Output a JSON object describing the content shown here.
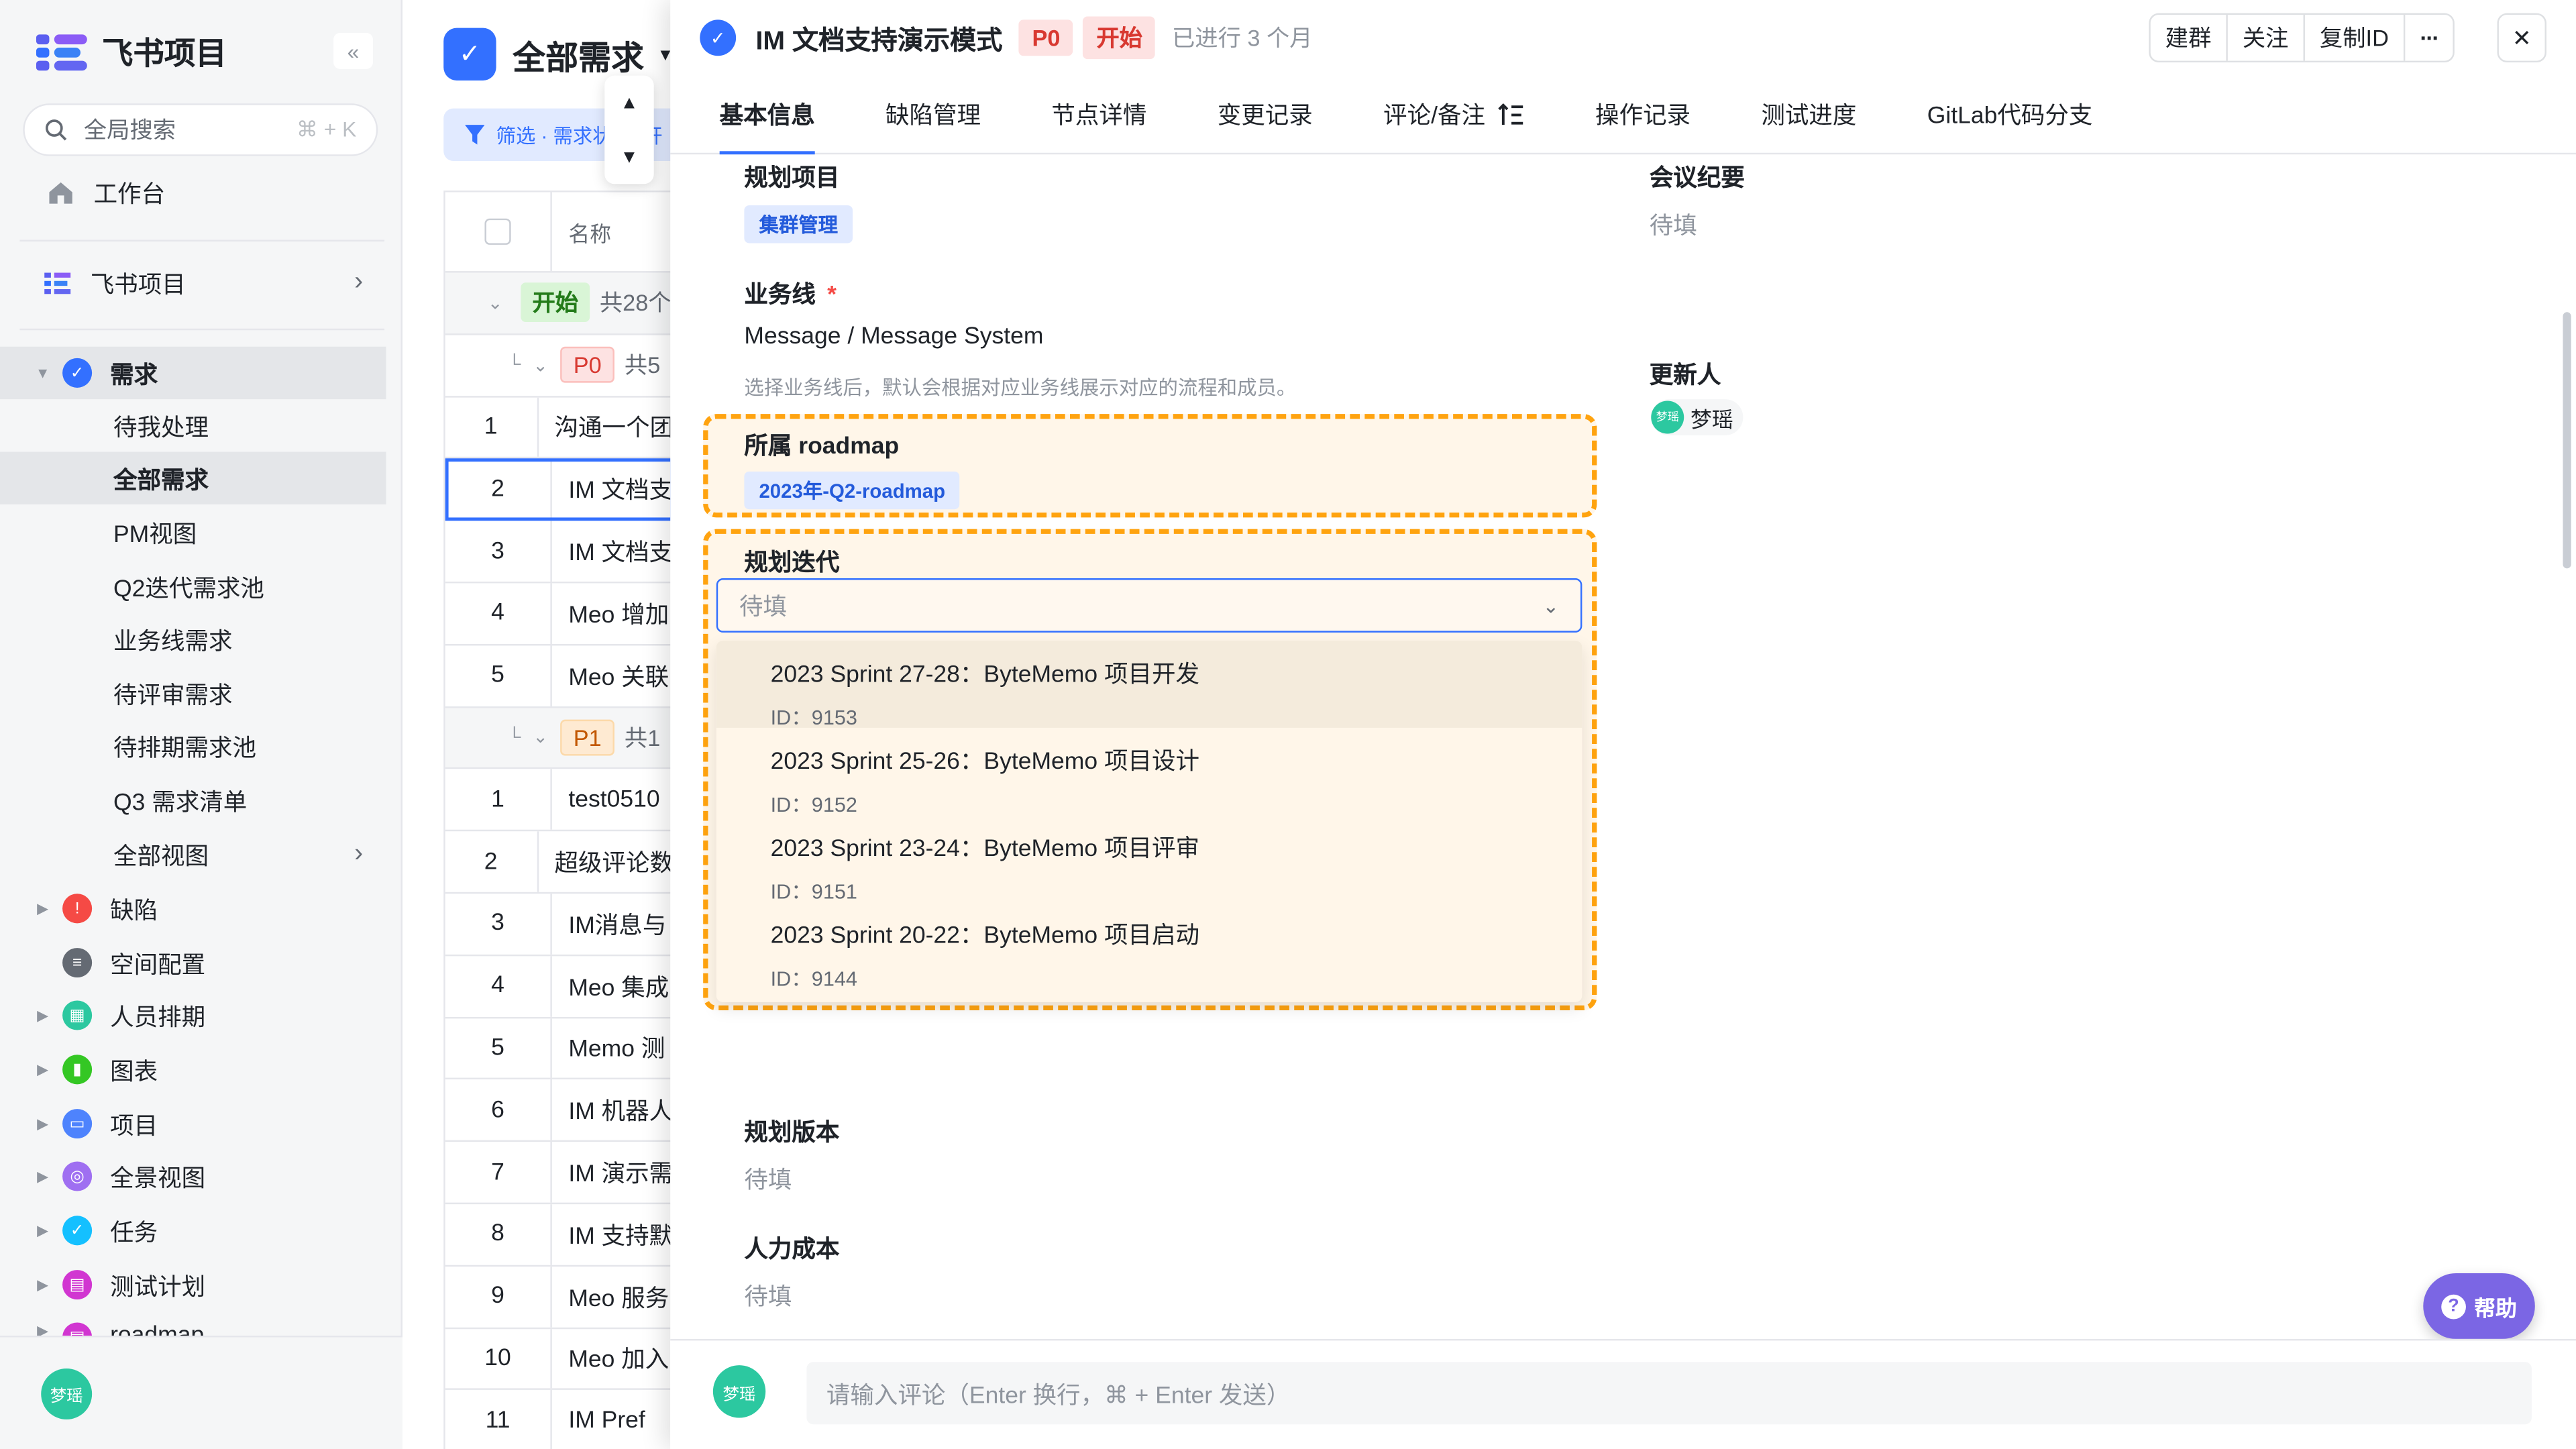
{
  "sidebar": {
    "app_name": "飞书项目",
    "collapse_icon": "«",
    "search_placeholder": "全局搜索",
    "search_shortcut": "⌘ + K",
    "workbench": "工作台",
    "space_name": "飞书项目",
    "items": [
      {
        "label": "需求",
        "color": "#3370ff",
        "glyph": "✓"
      },
      {
        "label": "缺陷",
        "color": "#f54a45",
        "glyph": "!"
      },
      {
        "label": "空间配置",
        "color": "#646a73",
        "glyph": "≡"
      },
      {
        "label": "人员排期",
        "color": "#2cc8a0",
        "glyph": "▦"
      },
      {
        "label": "图表",
        "color": "#34c724",
        "glyph": "▮"
      },
      {
        "label": "项目",
        "color": "#4e83fd",
        "glyph": "▭"
      },
      {
        "label": "全景视图",
        "color": "#9f6ff1",
        "glyph": "◎"
      },
      {
        "label": "任务",
        "color": "#14c0ff",
        "glyph": "✓"
      },
      {
        "label": "测试计划",
        "color": "#d136d1",
        "glyph": "▤"
      },
      {
        "label": "roadmap",
        "color": "#d136d1",
        "glyph": "▤"
      }
    ],
    "sub_items": [
      "待我处理",
      "全部需求",
      "PM视图",
      "Q2迭代需求池",
      "业务线需求",
      "待评审需求",
      "待排期需求池",
      "Q3 需求清单",
      "全部视图"
    ],
    "user_avatar": "梦瑶"
  },
  "list": {
    "title": "全部需求",
    "filter_label": "筛选 · 需求状态: 开",
    "column_name": "名称",
    "group1_status": "开始",
    "group1_count": "共28个",
    "p0_tag": "P0",
    "p0_count": "共5",
    "p1_tag": "P1",
    "p1_count": "共1",
    "p0_rows": [
      {
        "num": "1",
        "name": "沟通一个团"
      },
      {
        "num": "2",
        "name": "IM 文档支"
      },
      {
        "num": "3",
        "name": "IM 文档支"
      },
      {
        "num": "4",
        "name": "Meo 增加"
      },
      {
        "num": "5",
        "name": "Meo 关联"
      }
    ],
    "p1_rows": [
      {
        "num": "1",
        "name": "test0510"
      },
      {
        "num": "2",
        "name": "超级评论数"
      },
      {
        "num": "3",
        "name": "IM消息与"
      },
      {
        "num": "4",
        "name": "Meo 集成"
      },
      {
        "num": "5",
        "name": "Memo 测"
      },
      {
        "num": "6",
        "name": "IM 机器人"
      },
      {
        "num": "7",
        "name": "IM 演示需"
      },
      {
        "num": "8",
        "name": "IM 支持默"
      },
      {
        "num": "9",
        "name": "Meo 服务"
      },
      {
        "num": "10",
        "name": "Meo 加入"
      },
      {
        "num": "11",
        "name": "IM Pref"
      }
    ]
  },
  "detail": {
    "title": "IM 文档支持演示模式",
    "priority": "P0",
    "status": "开始",
    "elapsed": "已进行 3 个月",
    "actions": [
      "建群",
      "关注",
      "复制ID",
      "···"
    ],
    "close_icon": "✕",
    "tabs": [
      "基本信息",
      "缺陷管理",
      "节点详情",
      "变更记录",
      "评论/备注",
      "操作记录",
      "测试进度",
      "GitLab代码分支"
    ],
    "fields": {
      "planned_project_label": "规划项目",
      "planned_project_value": "集群管理",
      "meeting_label": "会议纪要",
      "meeting_value": "待填",
      "business_line_label": "业务线",
      "required_mark": "*",
      "business_line_value": "Message / Message System",
      "business_line_hint": "选择业务线后，默认会根据对应业务线展示对应的流程和成员。",
      "updater_label": "更新人",
      "updater_value": "梦瑶",
      "roadmap_label": "所属 roadmap",
      "roadmap_value": "2023年-Q2-roadmap",
      "iteration_label": "规划迭代",
      "iteration_placeholder": "待填",
      "version_label": "规划版本",
      "version_value": "待填",
      "cost_label": "人力成本",
      "cost_value": "待填"
    },
    "iteration_options": [
      {
        "title": "2023 Sprint 27-28：ByteMemo 项目开发",
        "id": "ID：9153"
      },
      {
        "title": "2023 Sprint 25-26：ByteMemo 项目设计",
        "id": "ID：9152"
      },
      {
        "title": "2023 Sprint 23-24：ByteMemo 项目评审",
        "id": "ID：9151"
      },
      {
        "title": "2023 Sprint 20-22：ByteMemo 项目启动",
        "id": "ID：9144"
      }
    ],
    "help_label": "帮助",
    "comment_placeholder": "请输入评论（Enter 换行，⌘ + Enter 发送）",
    "comment_avatar": "梦瑶"
  },
  "colors": {
    "accent": "#3370ff",
    "highlight": "#ffa30f",
    "danger": "#d83931"
  }
}
